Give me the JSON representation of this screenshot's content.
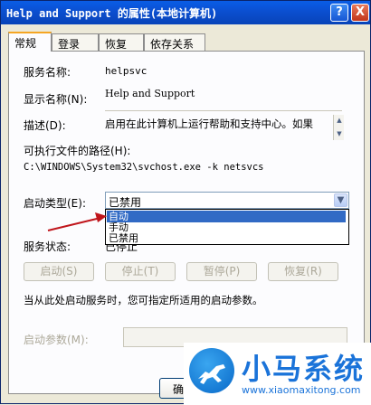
{
  "window": {
    "title": "Help and Support 的属性(本地计算机)",
    "help_btn": "?",
    "close_btn": "X"
  },
  "tabs": [
    {
      "label": "常规",
      "active": true
    },
    {
      "label": "登录",
      "active": false
    },
    {
      "label": "恢复",
      "active": false
    },
    {
      "label": "依存关系",
      "active": false
    }
  ],
  "general": {
    "service_name_label": "服务名称:",
    "service_name_value": "helpsvc",
    "display_name_label": "显示名称(N):",
    "display_name_value": "Help and Support",
    "description_label": "描述(D):",
    "description_value": "启用在此计算机上运行帮助和支持中心。如果",
    "exe_path_label": "可执行文件的路径(H):",
    "exe_path_value": "C:\\WINDOWS\\System32\\svchost.exe -k netsvcs",
    "startup_type_label": "启动类型(E):",
    "startup_type_value": "已禁用",
    "startup_options": [
      "自动",
      "手动",
      "已禁用"
    ],
    "startup_selected_option": "自动",
    "service_status_label": "服务状态:",
    "service_status_value": "已停止",
    "buttons": {
      "start": "启动(S)",
      "stop": "停止(T)",
      "pause": "暂停(P)",
      "resume": "恢复(R)"
    },
    "hint_text": "当从此处启动服务时，您可指定所适用的启动参数。",
    "start_params_label": "启动参数(M):",
    "start_params_value": "",
    "ok_button": "确"
  },
  "watermark": {
    "brand_text": "小马系统",
    "url": "www.xiaomaxitong.com"
  },
  "colors": {
    "title_bar": "#0b4fd0",
    "selection": "#316ac5",
    "annotation_arrow": "#c0151b",
    "brand_blue": "#1a73d9"
  }
}
